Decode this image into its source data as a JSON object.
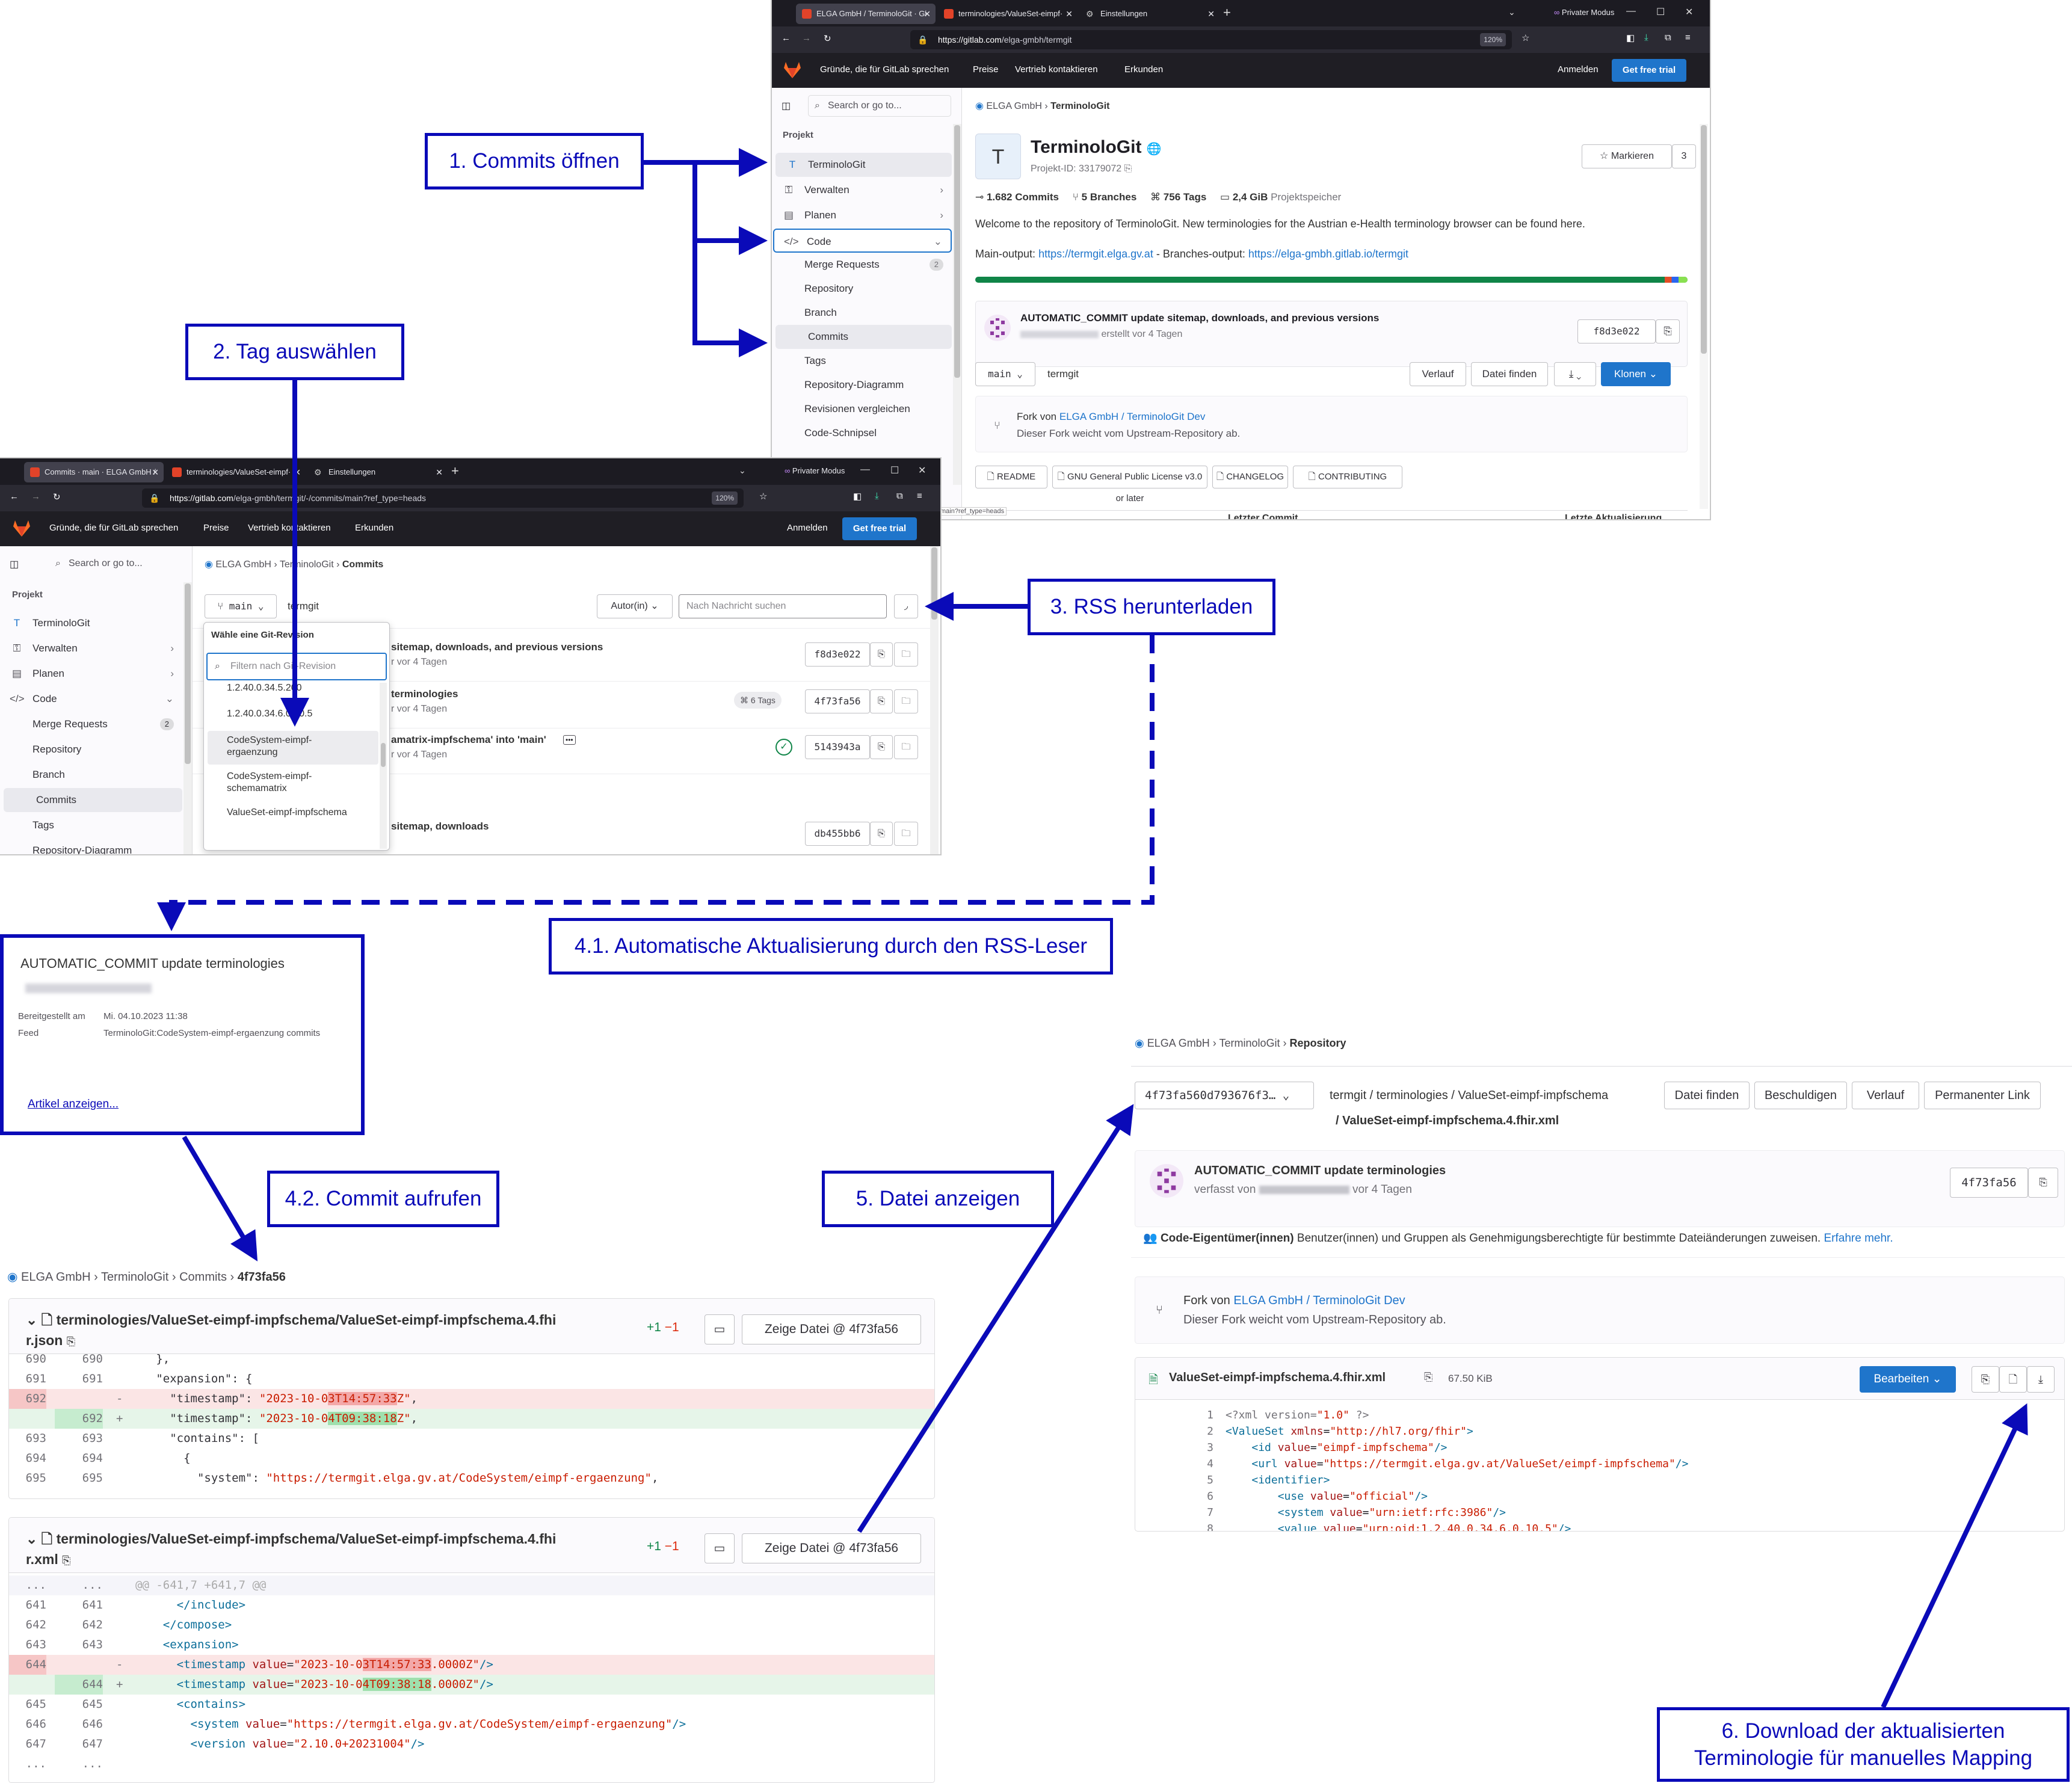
{
  "callouts": {
    "c1": "1. Commits öffnen",
    "c2": "2. Tag auswählen",
    "c3": "3. RSS herunterladen",
    "c41": "4.1. Automatische Aktualisierung durch den RSS-Leser",
    "c42": "4.2. Commit aufrufen",
    "c5": "5. Datei anzeigen",
    "c6a": "6. Download der aktualisierten",
    "c6b": "Terminologie für manuelles Mapping"
  },
  "win1": {
    "tabs": [
      "ELGA GmbH / TerminoloGit · Gi",
      "terminologies/ValueSet-eimpf·",
      "Einstellungen"
    ],
    "private": "Privater Modus",
    "url_host": "https://gitlab.com",
    "url_path": "/elga-gmbh/termgit",
    "zoom": "120%",
    "nav": [
      "Gründe, die für GitLab sprechen",
      "Preise",
      "Vertrieb kontaktieren",
      "Erkunden"
    ],
    "signin": "Anmelden",
    "trial": "Get free trial",
    "search": "Search or go to...",
    "section": "Projekt",
    "sidebar": [
      {
        "label": "TerminoloGit",
        "icon": "T"
      },
      {
        "label": "Verwalten",
        "icon": "⚿"
      },
      {
        "label": "Planen",
        "icon": "▤"
      },
      {
        "label": "Code",
        "icon": "</>"
      },
      {
        "label": "Merge Requests",
        "badge": "2"
      },
      {
        "label": "Repository"
      },
      {
        "label": "Branch"
      },
      {
        "label": "Commits"
      },
      {
        "label": "Tags"
      },
      {
        "label": "Repository-Diagramm"
      },
      {
        "label": "Revisionen vergleichen"
      },
      {
        "label": "Code-Schnipsel"
      }
    ],
    "breadcrumb": [
      "ELGA GmbH",
      "TerminoloGit"
    ],
    "avatar": "T",
    "title": "TerminoloGit",
    "project_id": "Projekt-ID: 33179072",
    "star": "Markieren",
    "star_count": "3",
    "stats": [
      "1.682 Commits",
      "5 Branches",
      "756 Tags",
      "2,4 GiB"
    ],
    "stats_suffix": "Projektspeicher",
    "desc": "Welcome to the repository of TerminoloGit. New terminologies for the Austrian e-Health terminology browser can be found here.",
    "mainout_label": "Main-output: ",
    "mainout": "https://termgit.elga.gv.at",
    "branchout_label": " - Branches-output: ",
    "branchout": "https://elga-gmbh.gitlab.io/termgit",
    "commit_title": "AUTOMATIC_COMMIT update sitemap, downloads, and previous versions",
    "commit_meta": "erstellt vor 4 Tagen",
    "commit_sha": "f8d3e022",
    "branch": "main",
    "path": "termgit",
    "btn_history": "Verlauf",
    "btn_find": "Datei finden",
    "btn_clone": "Klonen",
    "fork_prefix": "Fork von ",
    "fork_link": "ELGA GmbH / TerminoloGit Dev",
    "fork_desc": "Dieser Fork weicht vom Upstream-Repository ab.",
    "files": [
      "README",
      "GNU General Public License v3.0 or later",
      "CHANGELOG",
      "CONTRIBUTING"
    ],
    "col1": "Letzter Commit",
    "col2": "Letzte Aktualisierung",
    "status_url": "main?ref_type=heads"
  },
  "win2": {
    "tabs": [
      "Commits · main · ELGA GmbH /",
      "terminologies/ValueSet-eimpf·",
      "Einstellungen"
    ],
    "private": "Privater Modus",
    "url_host": "https://gitlab.com",
    "url_path": "/elga-gmbh/termgit/-/commits/main?ref_type=heads",
    "zoom": "120%",
    "breadcrumb": [
      "ELGA GmbH",
      "TerminoloGit",
      "Commits"
    ],
    "branch": "main",
    "path": "termgit",
    "author": "Autor(in)",
    "search_msg": "Nach Nachricht suchen",
    "dd_title": "Wähle eine Git-Revision",
    "dd_search": "Filtern nach Git-Revision",
    "dd_items": [
      "1.2.40.0.34.5.200",
      "1.2.40.0.34.6.0.10.5",
      "CodeSystem-eimpf-ergaenzung",
      "CodeSystem-eimpf-schemamatrix",
      "ValueSet-eimpf-impfschema"
    ],
    "commits": [
      {
        "title": "sitemap, downloads, and previous versions",
        "meta": "r vor 4 Tagen",
        "sha": "f8d3e022"
      },
      {
        "title": "terminologies",
        "meta": "r vor 4 Tagen",
        "sha": "4f73fa56",
        "tags": "6 Tags"
      },
      {
        "title": "amatrix-impfschema' into 'main'",
        "meta": "r vor 4 Tagen",
        "sha": "5143943a"
      },
      {
        "title": "sitemap, downloads",
        "meta": "",
        "sha": "db455bb6"
      }
    ],
    "sidebar": [
      "TerminoloGit",
      "Verwalten",
      "Planen",
      "Code",
      "Merge Requests",
      "Repository",
      "Branch",
      "Commits",
      "Tags",
      "Repository-Diagramm"
    ]
  },
  "rss": {
    "title": "AUTOMATIC_COMMIT update terminologies",
    "lbl_date": "Bereitgestellt am",
    "date": "Mi. 04.10.2023 11:38",
    "lbl_feed": "Feed",
    "feed": "TerminoloGit:CodeSystem-eimpf-ergaenzung commits",
    "link": "Artikel anzeigen..."
  },
  "diff": {
    "breadcrumb": [
      "ELGA GmbH",
      "TerminoloGit",
      "Commits",
      "4f73fa56"
    ],
    "f1_a": "terminologies/ValueSet-eimpf-impfschema/ValueSet-eimpf-impfschema.4.fhi",
    "f1_b": "r.json",
    "f2_a": "terminologies/ValueSet-eimpf-impfschema/ValueSet-eimpf-impfschema.4.fhi",
    "f2_b": "r.xml",
    "plus": "+1",
    "minus": "−1",
    "view_btn": "Zeige Datei @ 4f73fa56",
    "hunk2": "@@ -641,7 +641,7 @@"
  },
  "repo": {
    "breadcrumb": [
      "ELGA GmbH",
      "TerminoloGit",
      "Repository"
    ],
    "ref": "4f73fa560d793676f3…",
    "path": "termgit / terminologies / ValueSet-eimpf-impfschema",
    "file_path": "/ ValueSet-eimpf-impfschema.4.fhir.xml",
    "btns": [
      "Datei finden",
      "Beschuldigen",
      "Verlauf",
      "Permanenter Link"
    ],
    "commit_title": "AUTOMATIC_COMMIT update terminologies",
    "commit_meta_a": "verfasst von",
    "commit_meta_b": "vor 4 Tagen",
    "commit_sha": "4f73fa56",
    "owners_lbl": "Code-Eigentümer(innen)",
    "owners_text": "Benutzer(innen) und Gruppen als Genehmigungsberechtigte für bestimmte Dateiänderungen zuweisen.",
    "owners_link": "Erfahre mehr.",
    "fork_prefix": "Fork von ",
    "fork_link": "ELGA GmbH / TerminoloGit Dev",
    "fork_desc": "Dieser Fork weicht vom Upstream-Repository ab.",
    "file_name": "ValueSet-eimpf-impfschema.4.fhir.xml",
    "file_size": "67.50 KiB",
    "edit": "Bearbeiten"
  }
}
